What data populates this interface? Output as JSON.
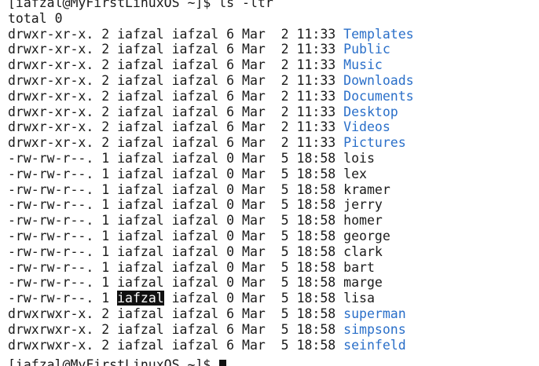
{
  "terminal": {
    "prompt": "[iafzal@MyFirstLinuxOS ~]$",
    "command": " ls -ltr",
    "total": "total 0",
    "colors": {
      "directory": "#2a6fc9",
      "text": "#1a1a1a",
      "background": "#ffffff"
    },
    "entries": [
      {
        "meta": "drwxr-xr-x. 2 iafzal iafzal 6 Mar  2 11:33 ",
        "name": "Templates",
        "is_dir": true
      },
      {
        "meta": "drwxr-xr-x. 2 iafzal iafzal 6 Mar  2 11:33 ",
        "name": "Public",
        "is_dir": true
      },
      {
        "meta": "drwxr-xr-x. 2 iafzal iafzal 6 Mar  2 11:33 ",
        "name": "Music",
        "is_dir": true
      },
      {
        "meta": "drwxr-xr-x. 2 iafzal iafzal 6 Mar  2 11:33 ",
        "name": "Downloads",
        "is_dir": true
      },
      {
        "meta": "drwxr-xr-x. 2 iafzal iafzal 6 Mar  2 11:33 ",
        "name": "Documents",
        "is_dir": true
      },
      {
        "meta": "drwxr-xr-x. 2 iafzal iafzal 6 Mar  2 11:33 ",
        "name": "Desktop",
        "is_dir": true
      },
      {
        "meta": "drwxr-xr-x. 2 iafzal iafzal 6 Mar  2 11:33 ",
        "name": "Videos",
        "is_dir": true
      },
      {
        "meta": "drwxr-xr-x. 2 iafzal iafzal 6 Mar  2 11:33 ",
        "name": "Pictures",
        "is_dir": true
      },
      {
        "meta": "-rw-rw-r--. 1 iafzal iafzal 0 Mar  5 18:58 ",
        "name": "lois",
        "is_dir": false
      },
      {
        "meta": "-rw-rw-r--. 1 iafzal iafzal 0 Mar  5 18:58 ",
        "name": "lex",
        "is_dir": false
      },
      {
        "meta": "-rw-rw-r--. 1 iafzal iafzal 0 Mar  5 18:58 ",
        "name": "kramer",
        "is_dir": false
      },
      {
        "meta": "-rw-rw-r--. 1 iafzal iafzal 0 Mar  5 18:58 ",
        "name": "jerry",
        "is_dir": false
      },
      {
        "meta": "-rw-rw-r--. 1 iafzal iafzal 0 Mar  5 18:58 ",
        "name": "homer",
        "is_dir": false
      },
      {
        "meta": "-rw-rw-r--. 1 iafzal iafzal 0 Mar  5 18:58 ",
        "name": "george",
        "is_dir": false
      },
      {
        "meta": "-rw-rw-r--. 1 iafzal iafzal 0 Mar  5 18:58 ",
        "name": "clark",
        "is_dir": false
      },
      {
        "meta": "-rw-rw-r--. 1 iafzal iafzal 0 Mar  5 18:58 ",
        "name": "bart",
        "is_dir": false
      },
      {
        "meta": "-rw-rw-r--. 1 iafzal iafzal 0 Mar  5 18:58 ",
        "name": "marge",
        "is_dir": false
      },
      {
        "meta_pre": "-rw-rw-r--. 1 ",
        "selected": "iafzal",
        "meta_post": " iafzal 0 Mar  5 18:58 ",
        "name": "lisa",
        "is_dir": false
      },
      {
        "meta": "drwxrwxr-x. 2 iafzal iafzal 6 Mar  5 18:58 ",
        "name": "superman",
        "is_dir": true
      },
      {
        "meta": "drwxrwxr-x. 2 iafzal iafzal 6 Mar  5 18:58 ",
        "name": "simpsons",
        "is_dir": true
      },
      {
        "meta": "drwxrwxr-x. 2 iafzal iafzal 6 Mar  5 18:58 ",
        "name": "seinfeld",
        "is_dir": true
      }
    ],
    "final_prompt": "[iafzal@MyFirstLinuxOS ~]$ "
  }
}
